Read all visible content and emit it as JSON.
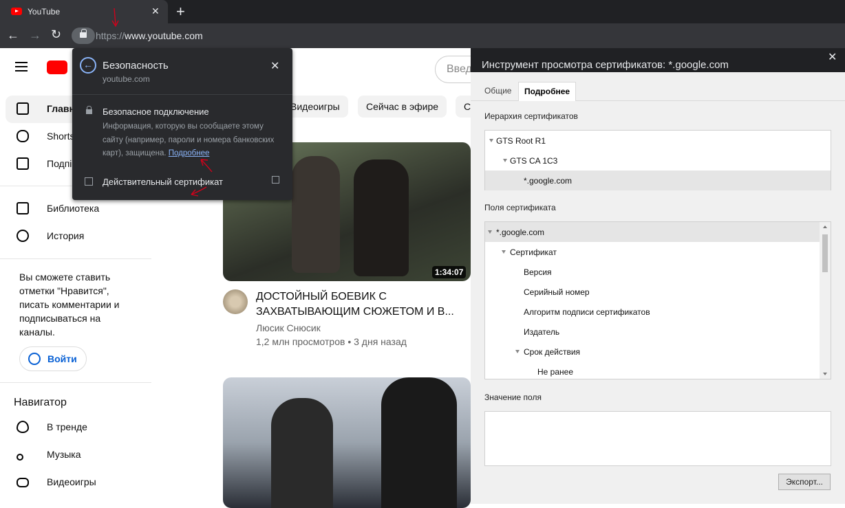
{
  "browser": {
    "tab_title": "YouTube",
    "tab_close": "✕",
    "new_tab": "+",
    "url_scheme": "https://",
    "url_host": "www.youtube.com",
    "back": "←",
    "forward": "→",
    "reload": "↻"
  },
  "youtube": {
    "search_placeholder": "Введ",
    "sidebar": {
      "items": [
        {
          "label": "Главн"
        },
        {
          "label": "Shorts"
        },
        {
          "label": "Подпі"
        },
        {
          "label": "Библиотека"
        },
        {
          "label": "История"
        }
      ],
      "signin_text": "Вы сможете ставить отметки \"Нравится\", писать комментарии и подписываться на каналы.",
      "signin_button": "Войти",
      "navigator_title": "Навигатор",
      "nav_items": [
        {
          "label": "В тренде"
        },
        {
          "label": "Музыка"
        },
        {
          "label": "Видеоигры"
        }
      ]
    },
    "chips": [
      "Видеоигры",
      "Сейчас в эфире",
      "С"
    ],
    "video1": {
      "duration": "1:34:07",
      "title": "ДОСТОЙНЫЙ БОЕВИК С ЗАХВАТЫВАЮЩИМ СЮЖЕТОМ И В...",
      "channel": "Люсик Снюсик",
      "meta": "1,2 млн просмотров • 3 дня назад"
    }
  },
  "security_popup": {
    "back": "←",
    "title": "Безопасность",
    "subtitle": "youtube.com",
    "close": "✕",
    "connection_title": "Безопасное подключение",
    "connection_info": "Информация, которую вы сообщаете этому сайту (например, пароли и номера банковских карт), защищена.",
    "more_link": "Подробнее",
    "certificate": "Действительный сертификат"
  },
  "cert_viewer": {
    "title": "Инструмент просмотра сертификатов: *.google.com",
    "close": "✕",
    "tabs": [
      "Общие",
      "Подробнее"
    ],
    "hierarchy_label": "Иерархия сертификатов",
    "hierarchy": [
      "GTS Root R1",
      "GTS CA 1C3",
      "*.google.com"
    ],
    "fields_label": "Поля сертификата",
    "fields": [
      "*.google.com",
      "Сертификат",
      "Версия",
      "Серийный номер",
      "Алгоритм подписи сертификатов",
      "Издатель",
      "Срок действия",
      "Не ранее"
    ],
    "value_label": "Значение поля",
    "export_button": "Экспорт..."
  }
}
